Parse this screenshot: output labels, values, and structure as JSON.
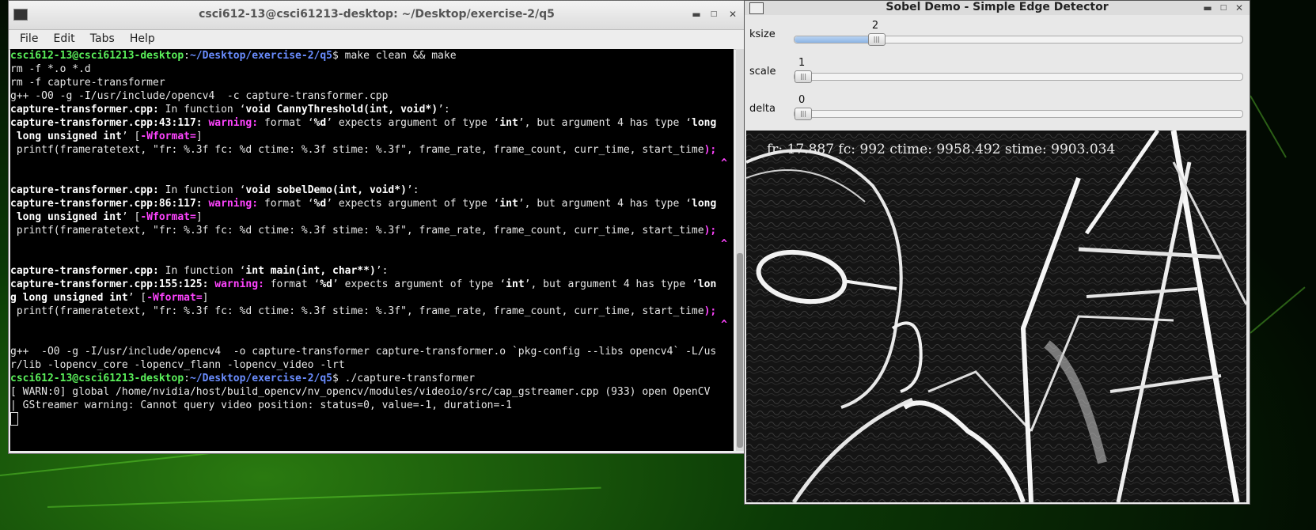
{
  "terminal": {
    "title": "csci612-13@csci61213-desktop: ~/Desktop/exercise-2/q5",
    "menu": [
      "File",
      "Edit",
      "Tabs",
      "Help"
    ],
    "prompt_user": "csci612-13@csci61213-desktop",
    "prompt_path": "~/Desktop/exercise-2/q5",
    "cmd1": " make clean && make",
    "l_rm1": "rm -f *.o *.d",
    "l_rm2": "rm -f capture-transformer",
    "l_gpp1": "g++ -O0 -g -I/usr/include/opencv4  -c capture-transformer.cpp",
    "f1_a": "capture-transformer.cpp:",
    "f1_b": " In function ‘",
    "f1_c": "void CannyThreshold(int, void*)",
    "f1_d": "’:",
    "w1_a": "capture-transformer.cpp:43:117:",
    "w_label": "warning:",
    "w_msg_a": " format ‘",
    "w_fmt": "%d",
    "w_msg_b": "’ expects argument of type ‘",
    "w_int": "int",
    "w_msg_c": "’, but argument 4 has type ‘",
    "w_long_1": "long",
    "w1_cont": " long unsigned int",
    "w_tail_a": "’ [",
    "w_flag": "-Wformat=",
    "w_tail_b": "]",
    "printf_line": " printf(frameratetext, \"fr: %.3f fc: %d ctime: %.3f stime: %.3f\", frame_rate, frame_count, curr_time, start_time",
    "printf_end": ");",
    "caret": "^",
    "f2_c": "void sobelDemo(int, void*)",
    "w2_a": "capture-transformer.cpp:86:117:",
    "f3_c": "int main(int, char**)",
    "w3_a": "capture-transformer.cpp:155:125:",
    "w_long_3": "lon",
    "w3_cont": "g long unsigned int",
    "link1": "g++  -O0 -g -I/usr/include/opencv4  -o capture-transformer capture-transformer.o `pkg-config --libs opencv4` -L/us",
    "link2": "r/lib -lopencv_core -lopencv_flann -lopencv_video -lrt",
    "cmd2": " ./capture-transformer",
    "warn1": "[ WARN:0] global /home/nvidia/host/build_opencv/nv_opencv/modules/videoio/src/cap_gstreamer.cpp (933) open OpenCV",
    "warn2": "| GStreamer warning: Cannot query video position: status=0, value=-1, duration=-1"
  },
  "sobel": {
    "title": "Sobel Demo - Simple Edge Detector",
    "trackbars": [
      {
        "label": "ksize",
        "value": "2",
        "fraction": 0.17
      },
      {
        "label": "scale",
        "value": "1",
        "fraction": 0.0
      },
      {
        "label": "delta",
        "value": "0",
        "fraction": 0.0
      }
    ],
    "overlay": "fr: 17.887 fc: 992 ctime: 9958.492 stime: 9903.034"
  },
  "colors": {
    "prompt_user": "#5af05a",
    "prompt_path": "#6a8dff",
    "warning": "#ff44ff"
  }
}
